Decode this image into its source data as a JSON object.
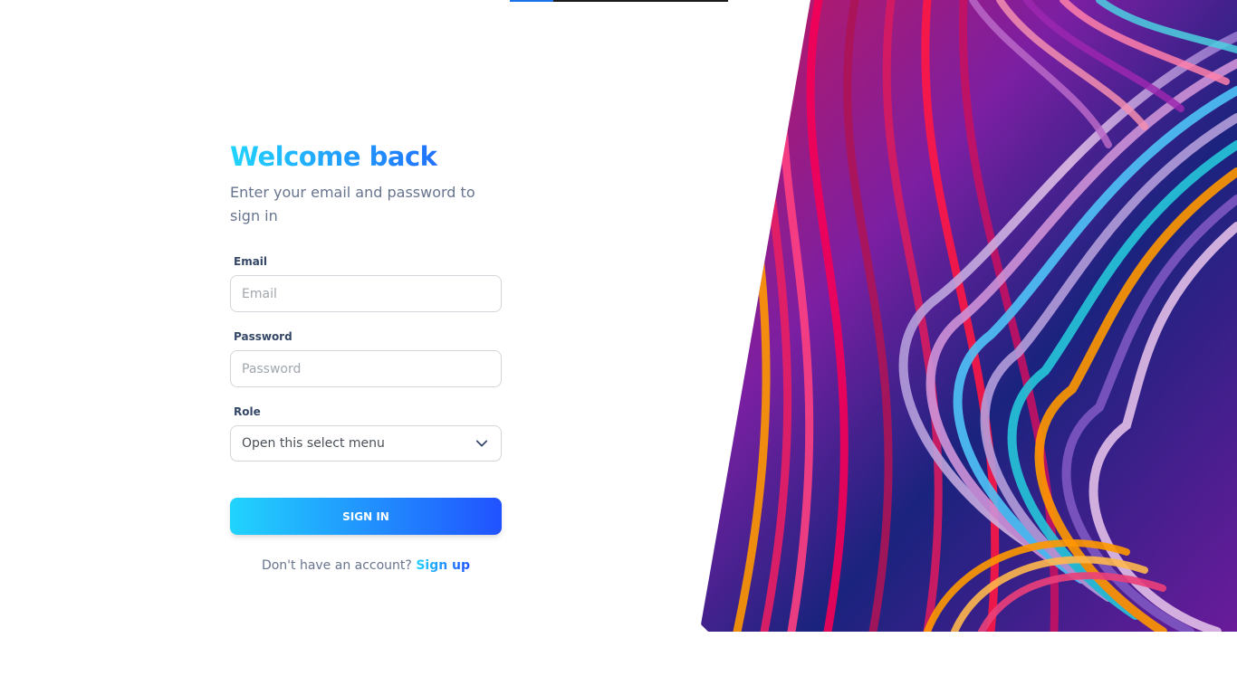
{
  "form": {
    "title": "Welcome back",
    "subtitle": "Enter your email and password to sign in",
    "email": {
      "label": "Email",
      "placeholder": "Email",
      "value": ""
    },
    "password": {
      "label": "Password",
      "placeholder": "Password",
      "value": ""
    },
    "role": {
      "label": "Role",
      "selected": "Open this select menu"
    },
    "submit_label": "SIGN IN",
    "footer": {
      "prompt": "Don't have an account?",
      "link_label": "Sign up"
    }
  },
  "theme": {
    "gradient_start": "#21d4fd",
    "gradient_end": "#2152ff",
    "text_primary": "#344767",
    "text_secondary": "#67748e"
  },
  "icons": {
    "select_chevron": "chevron-down-icon"
  }
}
